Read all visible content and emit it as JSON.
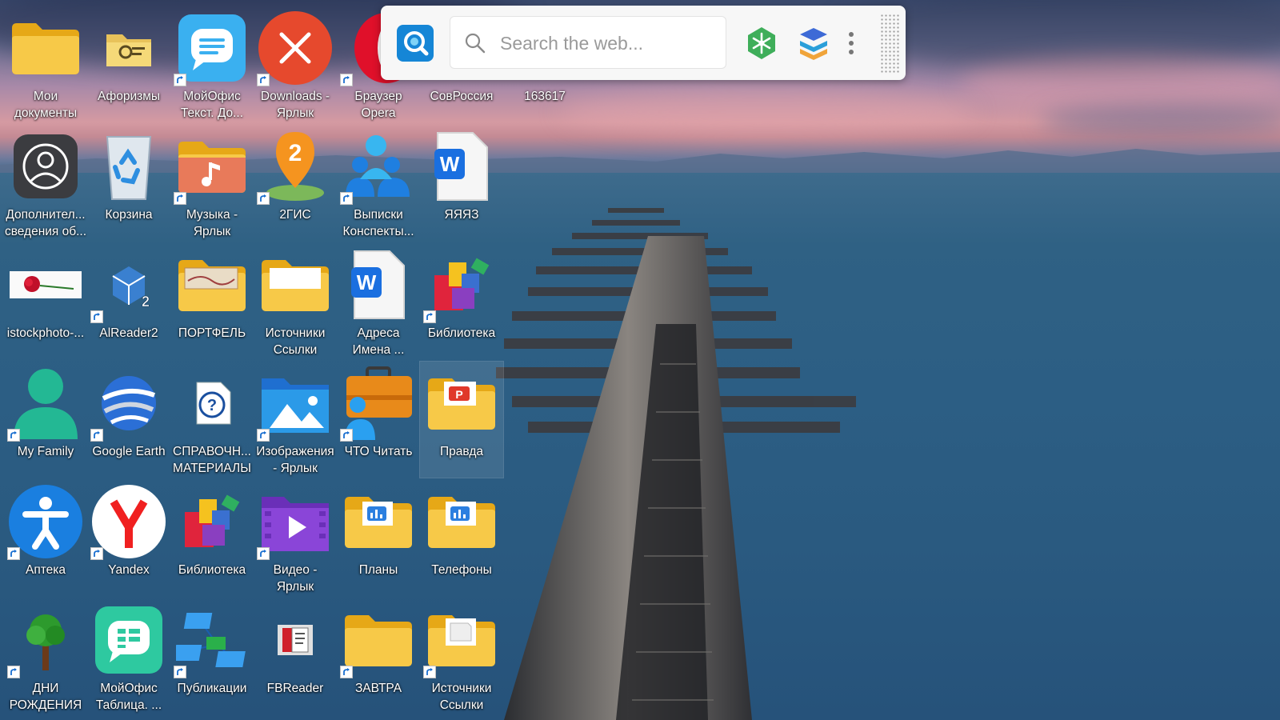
{
  "searchbar": {
    "placeholder": "Search the web...",
    "logo_icon": "search-logo-icon",
    "tools": [
      "snowflake-icon",
      "stack-layers-icon",
      "kebab-menu-icon"
    ]
  },
  "colors": {
    "folder": "#f7c948",
    "folder_dark": "#e6a817",
    "accent_blue": "#1a73e8",
    "red": "#e6492d"
  },
  "desktop": {
    "icons": [
      {
        "label": "Мои документы",
        "icon": "folder-icon"
      },
      {
        "label": "Афоризмы",
        "icon": "folder-settings-icon"
      },
      {
        "label": "МойОфис Текст. До...",
        "icon": "myoffice-text-icon"
      },
      {
        "label": "Downloads - Ярлык",
        "icon": "red-x-icon"
      },
      {
        "label": "Браузер Opera",
        "icon": "opera-icon"
      },
      {
        "label": "СовРоссия",
        "icon": "hidden-icon"
      },
      {
        "label": "163617",
        "icon": "hidden-icon"
      },
      {
        "label": "Дополнител... сведения об...",
        "icon": "account-circle-icon"
      },
      {
        "label": "Корзина",
        "icon": "recycle-bin-icon"
      },
      {
        "label": "Музыка - Ярлык",
        "icon": "music-folder-icon"
      },
      {
        "label": "2ГИС",
        "icon": "map-pin-icon"
      },
      {
        "label": "Выписки Конспекты...",
        "icon": "people-icon"
      },
      {
        "label": "ЯЯЯЗ",
        "icon": "word-document-icon"
      },
      {
        "label": "istockphoto-...",
        "icon": "rose-image-icon"
      },
      {
        "label": "AlReader2",
        "icon": "alreader-icon"
      },
      {
        "label": "ПОРТФЕЛЬ",
        "icon": "folder-image-icon"
      },
      {
        "label": "Источники Ссылки",
        "icon": "folder-open-icon"
      },
      {
        "label": "Адреса Имена ...",
        "icon": "word-document-icon"
      },
      {
        "label": "Библиотека",
        "icon": "library-blocks-icon"
      },
      {
        "label": "My Family",
        "icon": "family-person-icon"
      },
      {
        "label": "Google Earth",
        "icon": "google-earth-icon"
      },
      {
        "label": "СПРАВОЧН... МАТЕРИАЛЫ",
        "icon": "help-file-icon"
      },
      {
        "label": "Изображения - Ярлык",
        "icon": "pictures-folder-icon"
      },
      {
        "label": "ЧТО Читать",
        "icon": "briefcase-icon"
      },
      {
        "label": "Правда",
        "icon": "folder-pdf-icon"
      },
      {
        "label": "Аптека",
        "icon": "accessibility-icon"
      },
      {
        "label": "Yandex",
        "icon": "yandex-icon"
      },
      {
        "label": "Библиотека",
        "icon": "library-blocks-icon"
      },
      {
        "label": "Видео - Ярлык",
        "icon": "video-folder-icon"
      },
      {
        "label": "Планы",
        "icon": "folder-chart-icon"
      },
      {
        "label": "Телефоны",
        "icon": "folder-chart-icon"
      },
      {
        "label": "ДНИ РОЖДЕНИЯ",
        "icon": "tree-icon"
      },
      {
        "label": "МойОфис Таблица. ...",
        "icon": "myoffice-table-icon"
      },
      {
        "label": "Публикации",
        "icon": "network-icon"
      },
      {
        "label": "FBReader",
        "icon": "fbreader-icon"
      },
      {
        "label": "ЗАВТРА",
        "icon": "folder-icon"
      },
      {
        "label": "Источники Ссылки",
        "icon": "folder-doc-icon"
      }
    ]
  }
}
